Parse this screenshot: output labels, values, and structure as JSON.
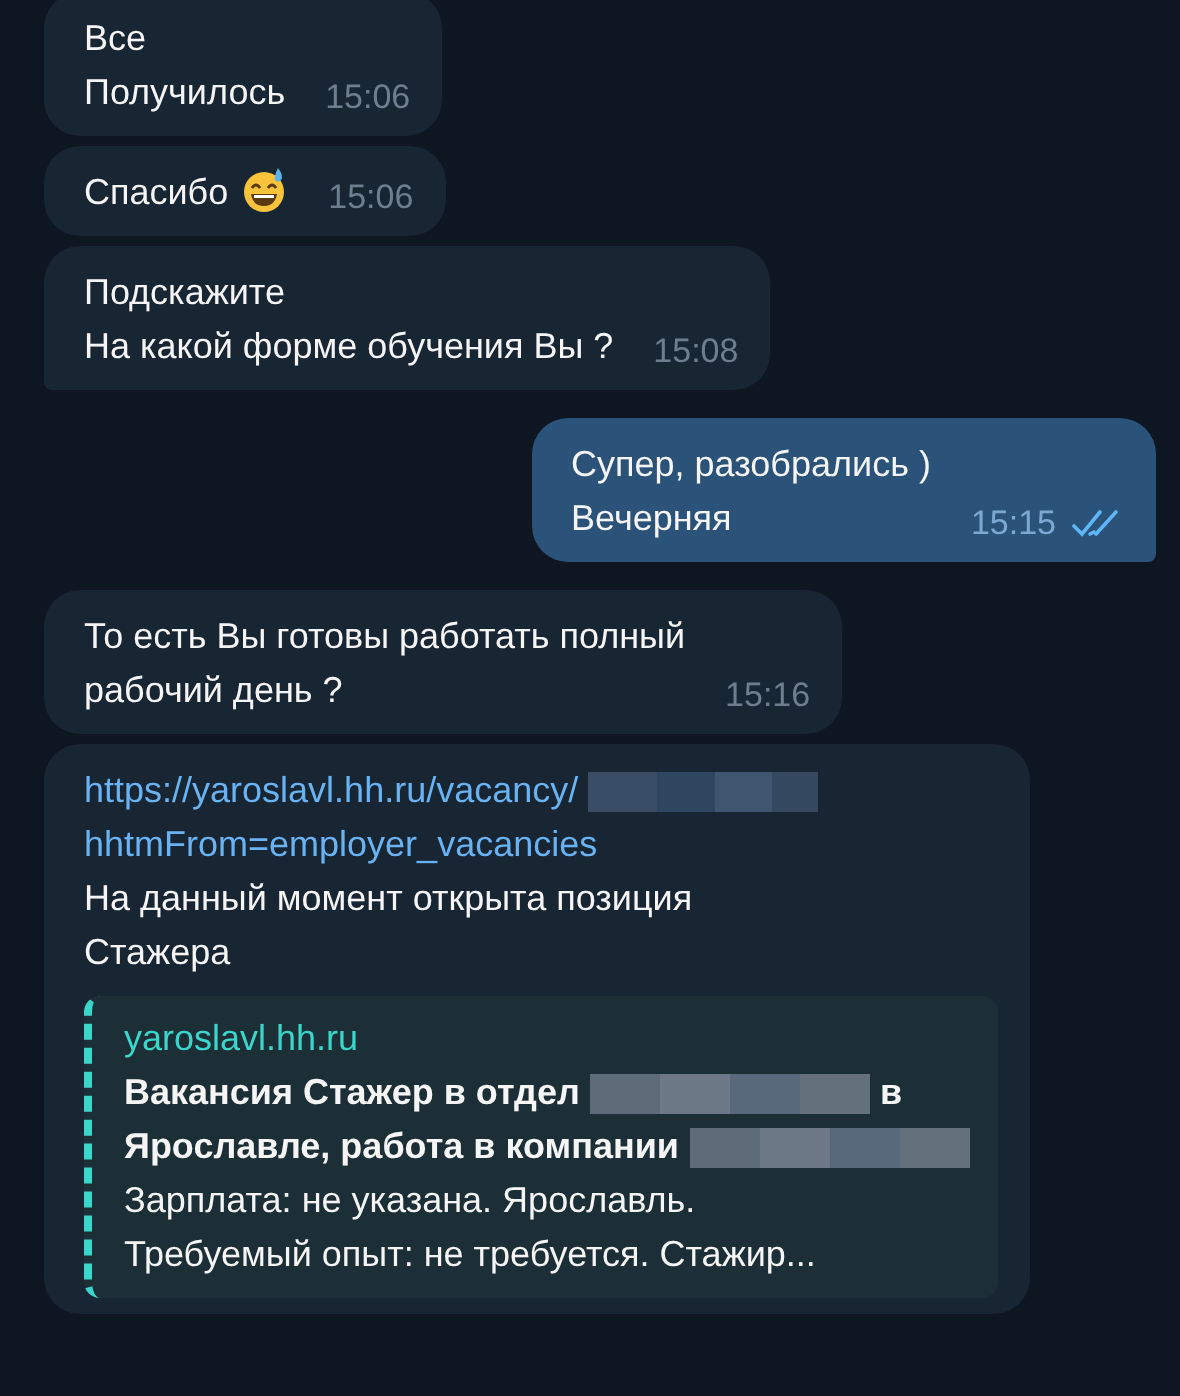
{
  "messages": [
    {
      "kind": "text",
      "outgoing": false,
      "tail": false,
      "text": "Все\nПолучилось",
      "time": "15:06"
    },
    {
      "kind": "text",
      "outgoing": false,
      "tail": false,
      "text": "Спасибо",
      "emoji": true,
      "time": "15:06"
    },
    {
      "kind": "text",
      "outgoing": false,
      "tail": true,
      "text": "Подскажите\nНа какой форме обучения Вы ?",
      "time": "15:08"
    },
    {
      "kind": "text",
      "outgoing": true,
      "tail": true,
      "text": "Супер, разобрались )\nВечерняя",
      "time": "15:15",
      "read": true
    },
    {
      "kind": "text",
      "outgoing": false,
      "tail": false,
      "text": "То есть Вы готовы работать полный\nрабочий день ?",
      "time": "15:16"
    },
    {
      "kind": "link",
      "outgoing": false,
      "tail": false,
      "link": [
        {
          "kind": "text",
          "text": "https://yaroslavl.hh.ru/vacancy/"
        },
        {
          "kind": "redacted"
        },
        {
          "kind": "break"
        },
        {
          "kind": "text",
          "text": "hhtmFrom=employer_vacancies"
        }
      ],
      "text": "На данный момент открыта позиция\nСтажера",
      "preview": {
        "site": "yaroslavl.hh.ru",
        "title": [
          {
            "kind": "text",
            "text": "Вакансия Стажер в отдел"
          },
          {
            "kind": "redacted"
          },
          {
            "kind": "text",
            "text": "в"
          },
          {
            "kind": "break"
          },
          {
            "kind": "text",
            "text": "Ярославле, работа в компании"
          },
          {
            "kind": "redacted"
          }
        ],
        "description": "Зарплата: не указана. Ярославль.\nТребуемый опыт: не требуется. Стажир..."
      }
    }
  ]
}
